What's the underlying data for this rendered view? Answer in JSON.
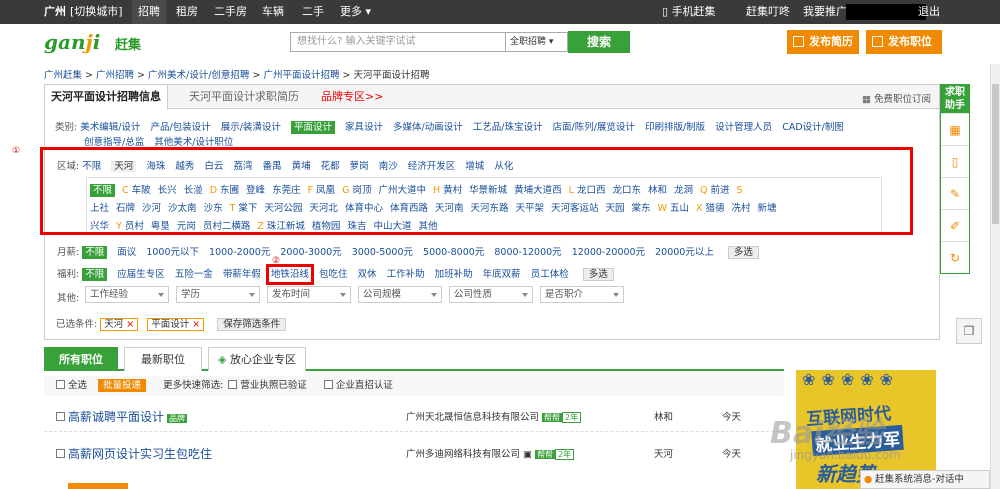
{
  "topbar": {
    "city": "广州",
    "switch_city": "[切换城市]",
    "nav": [
      "招聘",
      "租房",
      "二手房",
      "车辆",
      "二手",
      "更多"
    ],
    "mobile": "手机赶集",
    "jiudian": "赶集叮咚",
    "promote": "我要推广",
    "logout": "退出"
  },
  "header": {
    "logo_text": "ganji",
    "logo_cn": "赶集",
    "search_placeholder": "想找什么? 输入关键字试试",
    "search_category": "全职招聘",
    "search_button": "搜索",
    "publish_resume": "发布简历",
    "publish_job": "发布职位"
  },
  "breadcrumb": [
    "广州赶集",
    "广州招聘",
    "广州美术/设计/创意招聘",
    "广州平面设计招聘",
    "天河平面设计招聘"
  ],
  "panel": {
    "tabs": [
      "天河平面设计招聘信息",
      "天河平面设计求职简历",
      "品牌专区>>"
    ],
    "subscribe": "免费职位订阅",
    "category_label": "类别:",
    "categories_line1": [
      "美术编辑/设计",
      "产品/包装设计",
      "展示/装潢设计",
      "平面设计",
      "家具设计",
      "多媒体/动画设计",
      "工艺品/珠宝设计",
      "店面/陈列/展览设计",
      "印刷排版/制版",
      "设计管理人员",
      "CAD设计/制图"
    ],
    "categories_line2": [
      "创意指导/总监",
      "其他美术/设计职位"
    ],
    "region_label": "区域:",
    "regions": [
      "不限",
      "天河",
      "海珠",
      "越秀",
      "白云",
      "荔湾",
      "番禺",
      "黄埔",
      "花都",
      "萝岗",
      "南沙",
      "经济开发区",
      "增城",
      "从化"
    ],
    "sub_row1": [
      {
        "letter": "",
        "name": "不限",
        "selected": true
      },
      {
        "letter": "C",
        "name": "车陂"
      },
      {
        "letter": "",
        "name": "长兴"
      },
      {
        "letter": "",
        "name": "长湴"
      },
      {
        "letter": "D",
        "name": "东圃"
      },
      {
        "letter": "",
        "name": "登峰"
      },
      {
        "letter": "",
        "name": "东莞庄"
      },
      {
        "letter": "F",
        "name": "凤凰"
      },
      {
        "letter": "G",
        "name": "岗顶"
      },
      {
        "letter": "",
        "name": "广州大道中"
      },
      {
        "letter": "H",
        "name": "黄村"
      },
      {
        "letter": "",
        "name": "华景新城"
      },
      {
        "letter": "",
        "name": "黄埔大道西"
      },
      {
        "letter": "L",
        "name": "龙口西"
      },
      {
        "letter": "",
        "name": "龙口东"
      },
      {
        "letter": "",
        "name": "林和"
      },
      {
        "letter": "",
        "name": "龙洞"
      },
      {
        "letter": "Q",
        "name": "前进"
      },
      {
        "letter": "S",
        "name": ""
      }
    ],
    "sub_row2": [
      {
        "letter": "",
        "name": "上社"
      },
      {
        "letter": "",
        "name": "石牌"
      },
      {
        "letter": "",
        "name": "沙河"
      },
      {
        "letter": "",
        "name": "沙太南"
      },
      {
        "letter": "",
        "name": "沙东"
      },
      {
        "letter": "T",
        "name": "棠下"
      },
      {
        "letter": "",
        "name": "天河公园"
      },
      {
        "letter": "",
        "name": "天河北"
      },
      {
        "letter": "",
        "name": "体育中心"
      },
      {
        "letter": "",
        "name": "体育西路"
      },
      {
        "letter": "",
        "name": "天河南"
      },
      {
        "letter": "",
        "name": "天河东路"
      },
      {
        "letter": "",
        "name": "天平架"
      },
      {
        "letter": "",
        "name": "天河客运站"
      },
      {
        "letter": "",
        "name": "天园"
      },
      {
        "letter": "",
        "name": "棠东"
      },
      {
        "letter": "W",
        "name": "五山"
      },
      {
        "letter": "X",
        "name": "猎德"
      },
      {
        "letter": "",
        "name": "冼村"
      },
      {
        "letter": "",
        "name": "新塘"
      }
    ],
    "sub_row3": [
      {
        "letter": "",
        "name": "兴华"
      },
      {
        "letter": "Y",
        "name": "员村"
      },
      {
        "letter": "",
        "name": "粤垦"
      },
      {
        "letter": "",
        "name": "元岗"
      },
      {
        "letter": "",
        "name": "员村二横路"
      },
      {
        "letter": "Z",
        "name": "珠江新城"
      },
      {
        "letter": "",
        "name": "植物园"
      },
      {
        "letter": "",
        "name": "珠吉"
      },
      {
        "letter": "",
        "name": "中山大道"
      },
      {
        "letter": "",
        "name": "其他"
      }
    ],
    "salary_label": "月薪:",
    "salaries": [
      "不限",
      "面议",
      "1000元以下",
      "1000-2000元",
      "2000-3000元",
      "3000-5000元",
      "5000-8000元",
      "8000-12000元",
      "12000-20000元",
      "20000元以上"
    ],
    "multi_select": "多选",
    "welfare_label": "福利:",
    "welfares": [
      "不限",
      "应届生专区",
      "五险一金",
      "带薪年假",
      "地铁沿线",
      "包吃住",
      "双休",
      "工作补助",
      "加班补助",
      "年底双薪",
      "员工体检"
    ],
    "other_label": "其他:",
    "dropdowns": [
      "工作经验",
      "学历",
      "发布时间",
      "公司规模",
      "公司性质",
      "是否职介"
    ],
    "conditions_label": "已选条件:",
    "conditions": [
      "天河",
      "平面设计"
    ],
    "save_conditions": "保存筛选条件",
    "annot1": "①",
    "annot2": "②"
  },
  "list": {
    "tabs": [
      "所有职位",
      "最新职位",
      "放心企业专区"
    ],
    "select_all": "全选",
    "batch_deliver": "批量投递",
    "more_filter": "更多快速筛选:",
    "license_verified": "营业执照已验证",
    "company_verified": "企业直招认证",
    "jobs": [
      {
        "title": "高薪诚聘平面设计",
        "pin": "品牌",
        "company": "广州天北晟恒信息科技有限公司",
        "bang": "帮帮",
        "years": "2年",
        "area": "林和",
        "date": "今天"
      },
      {
        "title": "高薪网页设计实习生包吃住",
        "pin": "",
        "company": "广州多迪网络科技有限公司",
        "bang": "帮帮",
        "years": "2年",
        "area": "天河",
        "date": "今天"
      }
    ]
  },
  "ad": {
    "line1": "互联网时代",
    "line2": "就业生力军",
    "line3": "新趋势"
  },
  "helper": {
    "title": "求职助手"
  },
  "chat": "赶集系统消息-对话中",
  "watermark": {
    "main": "Bai经验",
    "sub": "jingyan.baidu.com"
  }
}
